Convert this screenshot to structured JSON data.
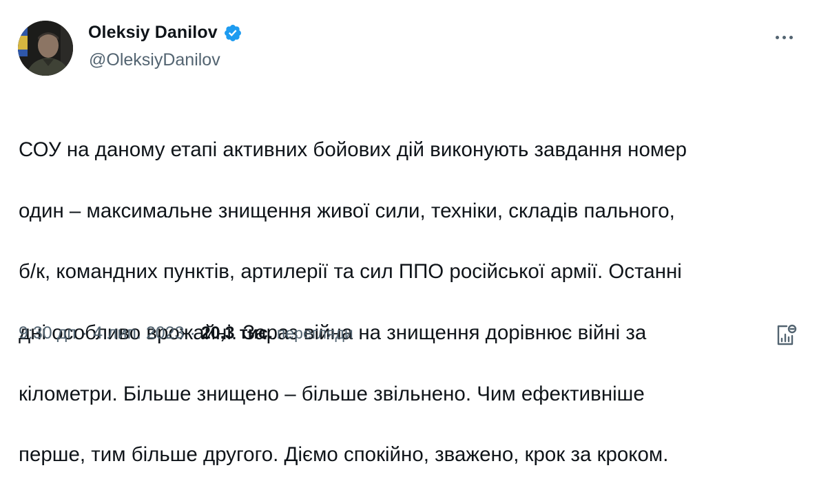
{
  "author": {
    "name": "Oleksiy Danilov",
    "handle": "@OleksiyDanilov",
    "verified": true,
    "verified_color": "#1d9bf0"
  },
  "tweet": {
    "lines": [
      "СОУ на даному етапі активних бойових дій виконують завдання номер",
      "один – максимальне знищення живої сили, техніки, складів пального,",
      "б/к, командних пунктів, артилерії та сил ППО російської армії. Останні",
      "дні особливо врожайні. Зараз війна на знищення дорівнює війні за",
      "кілометри. Більше знищено – більше звільнено. Чим ефективніше",
      "перше, тим більше другого. Діємо спокійно, зважено, крок за кроком."
    ]
  },
  "meta": {
    "time": "9:30 дп",
    "separator": "·",
    "date": "4 лип. 2023",
    "views_count": "20,3 тис.",
    "views_label": "перегляди"
  },
  "icons": {
    "more": "more-dots-icon",
    "verified": "verified-badge-icon",
    "analytics": "analytics-icon"
  }
}
